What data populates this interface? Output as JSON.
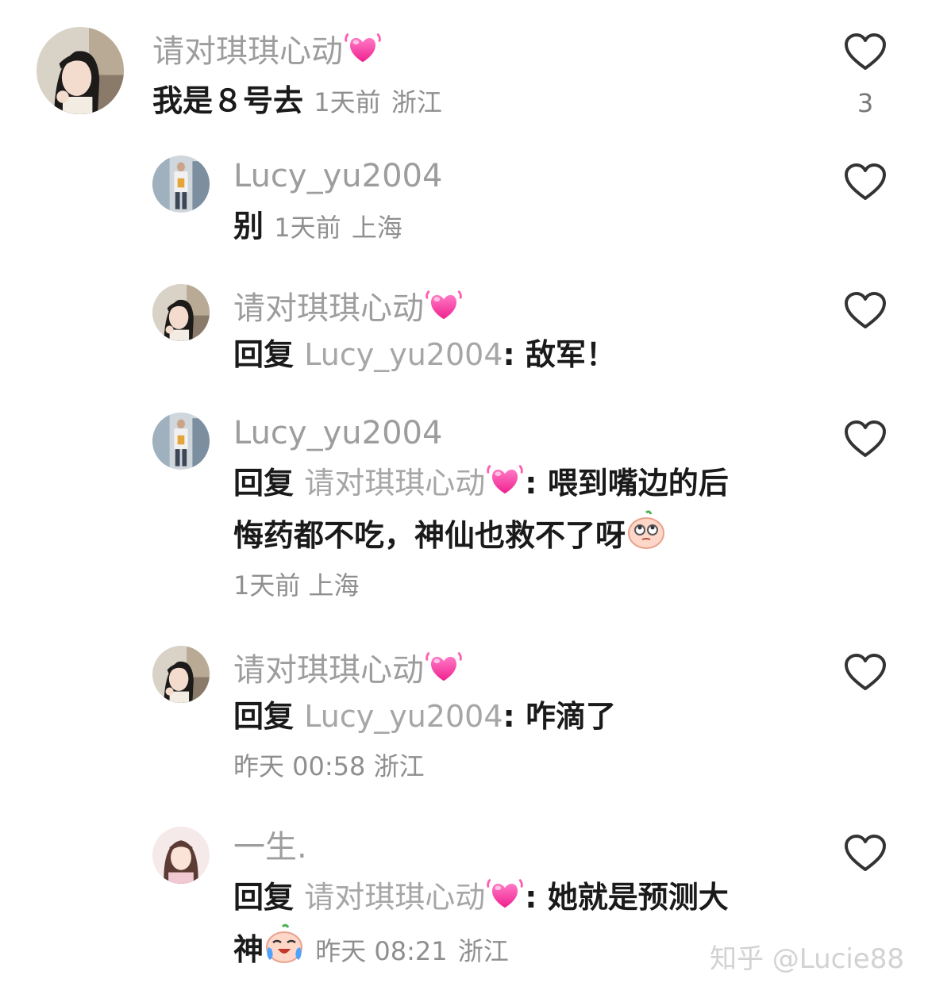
{
  "comments": [
    {
      "author": "请对琪琪心动",
      "text": "我是８号去",
      "time": "1天前",
      "region": "浙江",
      "like_count": "3",
      "avatar": "female-avatar-1",
      "icon_after_name": "growing-heart-emoji"
    },
    {
      "author": "Lucy_yu2004",
      "text": "别",
      "time": "1天前",
      "region": "上海",
      "like_count": "",
      "avatar": "male-avatar"
    },
    {
      "author": "请对琪琪心动",
      "reply_prefix": "回复",
      "reply_to": "Lucy_yu2004",
      "colon": ":",
      "text": "敌军！",
      "avatar": "female-avatar-1",
      "icon_after_name": "growing-heart-emoji"
    },
    {
      "author": "Lucy_yu2004",
      "reply_prefix": "回复",
      "reply_to": "请对琪琪心动",
      "colon": ":",
      "text_line1": "喂到嘴边的后",
      "text_line2": "悔药都不吃，神仙也救不了呀",
      "time": "1天前",
      "region": "上海",
      "avatar": "male-avatar",
      "icon_after_reply_to": "growing-heart-emoji",
      "trailing_emoji": "eye-roll-emoji"
    },
    {
      "author": "请对琪琪心动",
      "reply_prefix": "回复",
      "reply_to": "Lucy_yu2004",
      "colon": ":",
      "text": "咋滴了",
      "time": "昨天 00:58",
      "region": "浙江",
      "avatar": "female-avatar-1",
      "icon_after_name": "growing-heart-emoji"
    },
    {
      "author": "一生.",
      "reply_prefix": "回复",
      "reply_to": "请对琪琪心动",
      "colon": ":",
      "text_line1": "她就是预测大",
      "text_line2": "神",
      "time": "昨天 08:21",
      "region": "浙江",
      "avatar": "female-avatar-2",
      "icon_after_reply_to": "growing-heart-emoji",
      "trailing_emoji": "crying-laugh-emoji"
    }
  ],
  "watermark": "知乎 @Lucie88",
  "colors": {
    "heart_emoji": "#ff3fa4",
    "name_gray": "#9d9d9d",
    "meta_gray": "#8f8f8f",
    "text": "#1a1a1a",
    "like_outline": "#333333"
  }
}
